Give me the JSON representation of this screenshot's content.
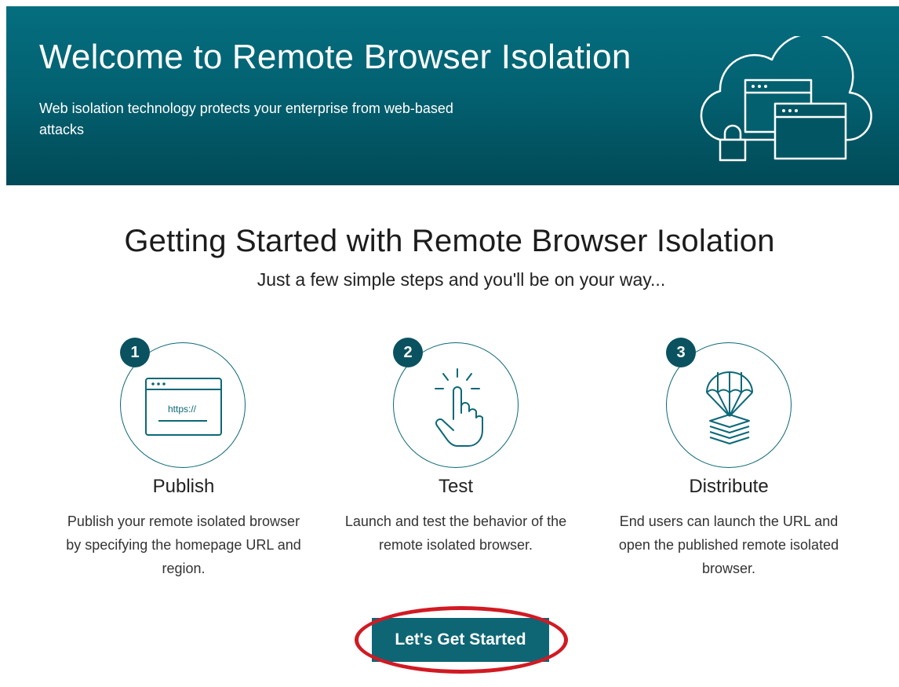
{
  "banner": {
    "title": "Welcome to Remote Browser Isolation",
    "subtitle": "Web isolation technology protects your enterprise from web-based attacks",
    "illustration": "cloud-browser-lock-icon"
  },
  "main": {
    "heading": "Getting Started with Remote Browser Isolation",
    "subheading": "Just a few simple steps and you'll be on your way..."
  },
  "steps": [
    {
      "number": "1",
      "title": "Publish",
      "description": "Publish your remote isolated browser by specifying the homepage URL and region.",
      "icon": "browser-window-icon",
      "icon_text": "https://"
    },
    {
      "number": "2",
      "title": "Test",
      "description": "Launch and test the behavior of the remote isolated browser.",
      "icon": "pointer-tap-icon"
    },
    {
      "number": "3",
      "title": "Distribute",
      "description": "End users can launch the URL and open the published remote isolated browser.",
      "icon": "parachute-delivery-icon"
    }
  ],
  "cta": {
    "label": "Let's Get Started"
  },
  "colors": {
    "banner": "#036272",
    "accent": "#0e6675",
    "badge": "#0a5260",
    "highlight_ring": "#d11a23"
  }
}
